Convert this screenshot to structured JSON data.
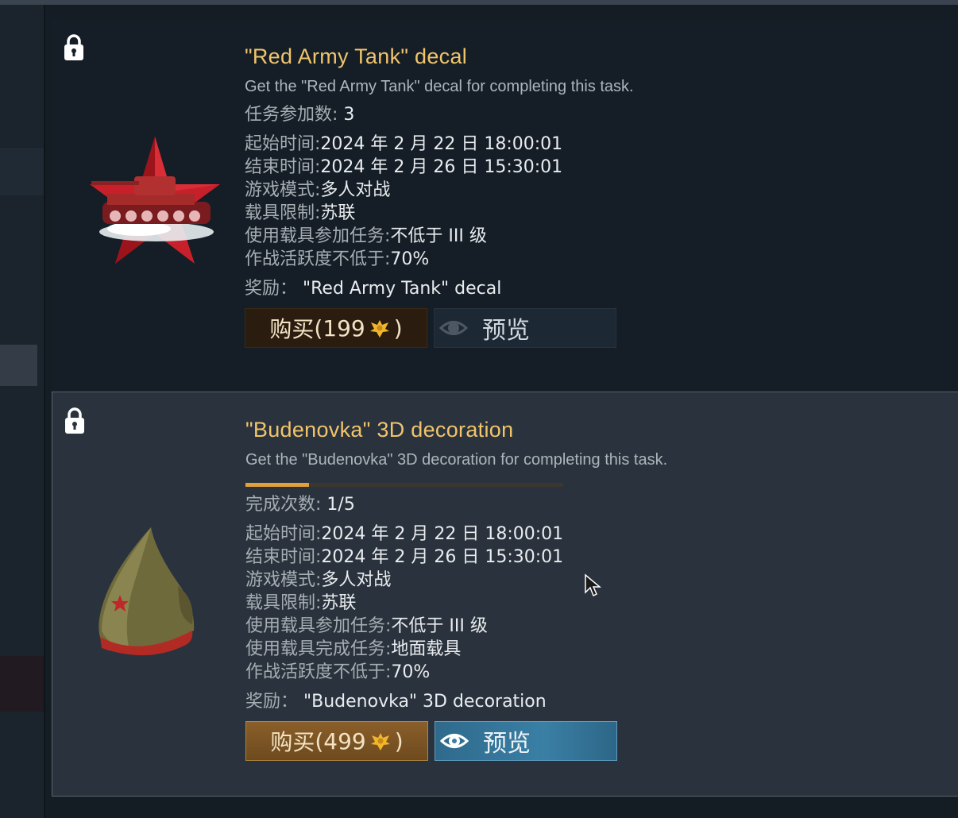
{
  "tasks": [
    {
      "title": "\"Red Army Tank\" decal",
      "description": "Get the \"Red Army Tank\" decal for completing this task.",
      "participation": {
        "label": "任务参加数:",
        "value": "3"
      },
      "details": [
        {
          "label": "起始时间:",
          "value": "2024 年 2 月 22 日 18:00:01"
        },
        {
          "label": "结束时间:",
          "value": "2024 年 2 月 26 日 15:30:01"
        },
        {
          "label": "游戏模式:",
          "value": "多人对战"
        },
        {
          "label": "载具限制:",
          "value": "苏联"
        },
        {
          "label": "使用载具参加任务:",
          "value": "不低于 III 级"
        },
        {
          "label": "作战活跃度不低于:",
          "value": "70%"
        }
      ],
      "reward": {
        "label": "奖励：",
        "value": "\"Red Army Tank\" decal"
      },
      "buy": {
        "label": "购买",
        "open": "(",
        "price": "199",
        "close": ")"
      },
      "preview_label": "预览"
    },
    {
      "title": "\"Budenovka\" 3D decoration",
      "description": "Get the \"Budenovka\" 3D decoration for completing this task.",
      "progress_fraction": 0.2,
      "completion": {
        "label": "完成次数:",
        "value": "1/5"
      },
      "details": [
        {
          "label": "起始时间:",
          "value": "2024 年 2 月 22 日 18:00:01"
        },
        {
          "label": "结束时间:",
          "value": "2024 年 2 月 26 日 15:30:01"
        },
        {
          "label": "游戏模式:",
          "value": "多人对战"
        },
        {
          "label": "载具限制:",
          "value": "苏联"
        },
        {
          "label": "使用载具参加任务:",
          "value": "不低于 III 级"
        },
        {
          "label": "使用载具完成任务:",
          "value": "地面载具"
        },
        {
          "label": "作战活跃度不低于:",
          "value": "70%"
        }
      ],
      "reward": {
        "label": "奖励：",
        "value": "\"Budenovka\" 3D decoration"
      },
      "buy": {
        "label": "购买",
        "open": "(",
        "price": "499",
        "close": ")"
      },
      "preview_label": "预览"
    }
  ],
  "colors": {
    "title": "#f0c46b",
    "progress_fill": "#e0a03a",
    "preview_active": "#3a7fa5"
  },
  "icons": [
    "lock-icon",
    "golden-eagle-icon",
    "eye-icon",
    "mouse-cursor-icon"
  ]
}
